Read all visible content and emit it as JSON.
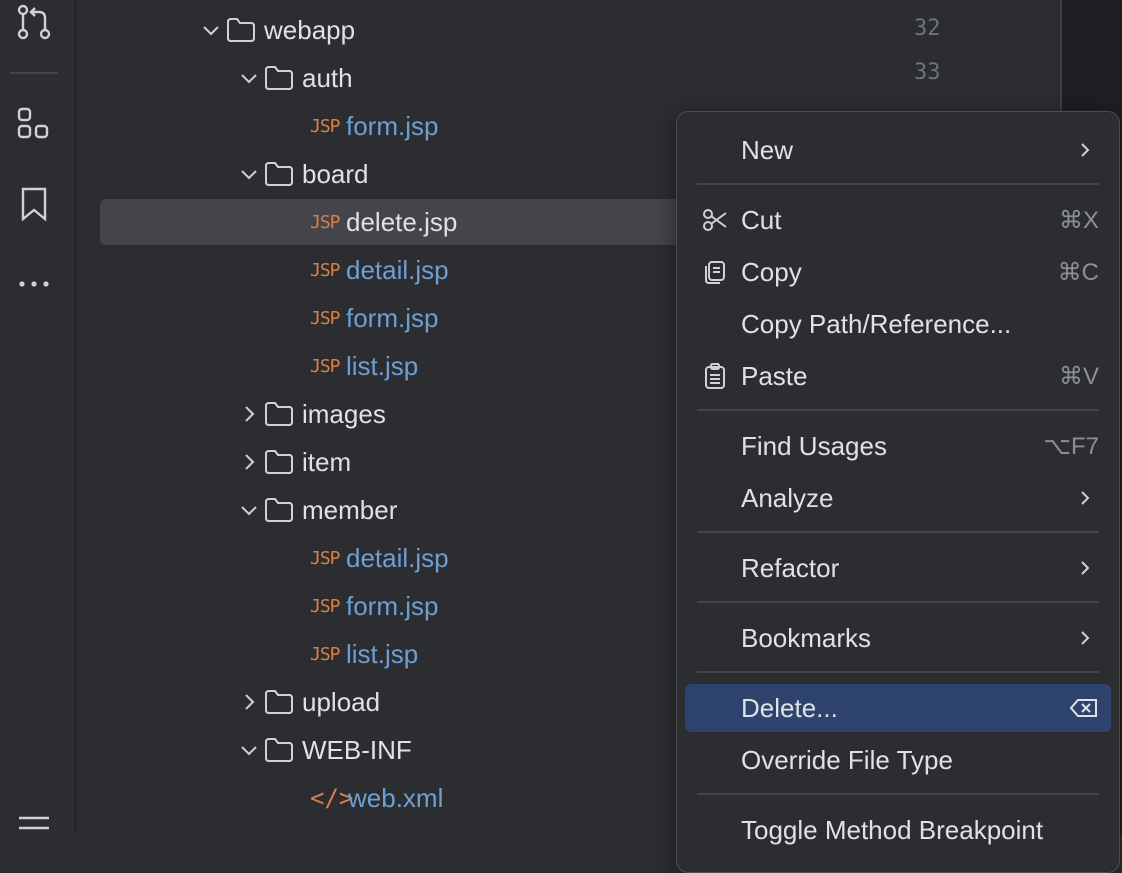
{
  "activity_bar": {
    "icons": [
      "git-pull-request-icon",
      "structure-icon",
      "bookmark-icon",
      "more-icon",
      "list-icon"
    ]
  },
  "tree": {
    "items": [
      {
        "label": "webapp",
        "kind": "folder",
        "expanded": true
      },
      {
        "label": "auth",
        "kind": "folder",
        "expanded": true
      },
      {
        "label": "form.jsp",
        "kind": "jsp"
      },
      {
        "label": "board",
        "kind": "folder",
        "expanded": true
      },
      {
        "label": "delete.jsp",
        "kind": "jsp",
        "selected": true
      },
      {
        "label": "detail.jsp",
        "kind": "jsp"
      },
      {
        "label": "form.jsp",
        "kind": "jsp"
      },
      {
        "label": "list.jsp",
        "kind": "jsp"
      },
      {
        "label": "images",
        "kind": "folder",
        "expanded": false
      },
      {
        "label": "item",
        "kind": "folder",
        "expanded": false
      },
      {
        "label": "member",
        "kind": "folder",
        "expanded": true
      },
      {
        "label": "detail.jsp",
        "kind": "jsp"
      },
      {
        "label": "form.jsp",
        "kind": "jsp"
      },
      {
        "label": "list.jsp",
        "kind": "jsp"
      },
      {
        "label": "upload",
        "kind": "folder",
        "expanded": false
      },
      {
        "label": "WEB-INF",
        "kind": "folder",
        "expanded": true
      },
      {
        "label": "web.xml",
        "kind": "xml"
      }
    ],
    "jsp_badge": "JSP",
    "xml_badge": "</>"
  },
  "editor": {
    "line_numbers": [
      "32",
      "33"
    ]
  },
  "context_menu": {
    "items": [
      {
        "label": "New",
        "submenu": true
      },
      {
        "label": "Cut",
        "shortcut": "⌘X",
        "icon": "scissors-icon"
      },
      {
        "label": "Copy",
        "shortcut": "⌘C",
        "icon": "copy-icon"
      },
      {
        "label": "Copy Path/Reference..."
      },
      {
        "label": "Paste",
        "shortcut": "⌘V",
        "icon": "clipboard-icon"
      },
      {
        "label": "Find Usages",
        "shortcut": "⌥F7"
      },
      {
        "label": "Analyze",
        "submenu": true
      },
      {
        "label": "Refactor",
        "submenu": true
      },
      {
        "label": "Bookmarks",
        "submenu": true
      },
      {
        "label": "Delete...",
        "highlighted": true,
        "icon": "delete-icon"
      },
      {
        "label": "Override File Type"
      },
      {
        "label": "Toggle Method Breakpoint"
      }
    ]
  },
  "colors": {
    "background": "#2b2d30",
    "selection": "#43454a",
    "menu_highlight": "#2e436e",
    "file_name": "#6e9fd2",
    "jsp_icon": "#d97f47"
  }
}
